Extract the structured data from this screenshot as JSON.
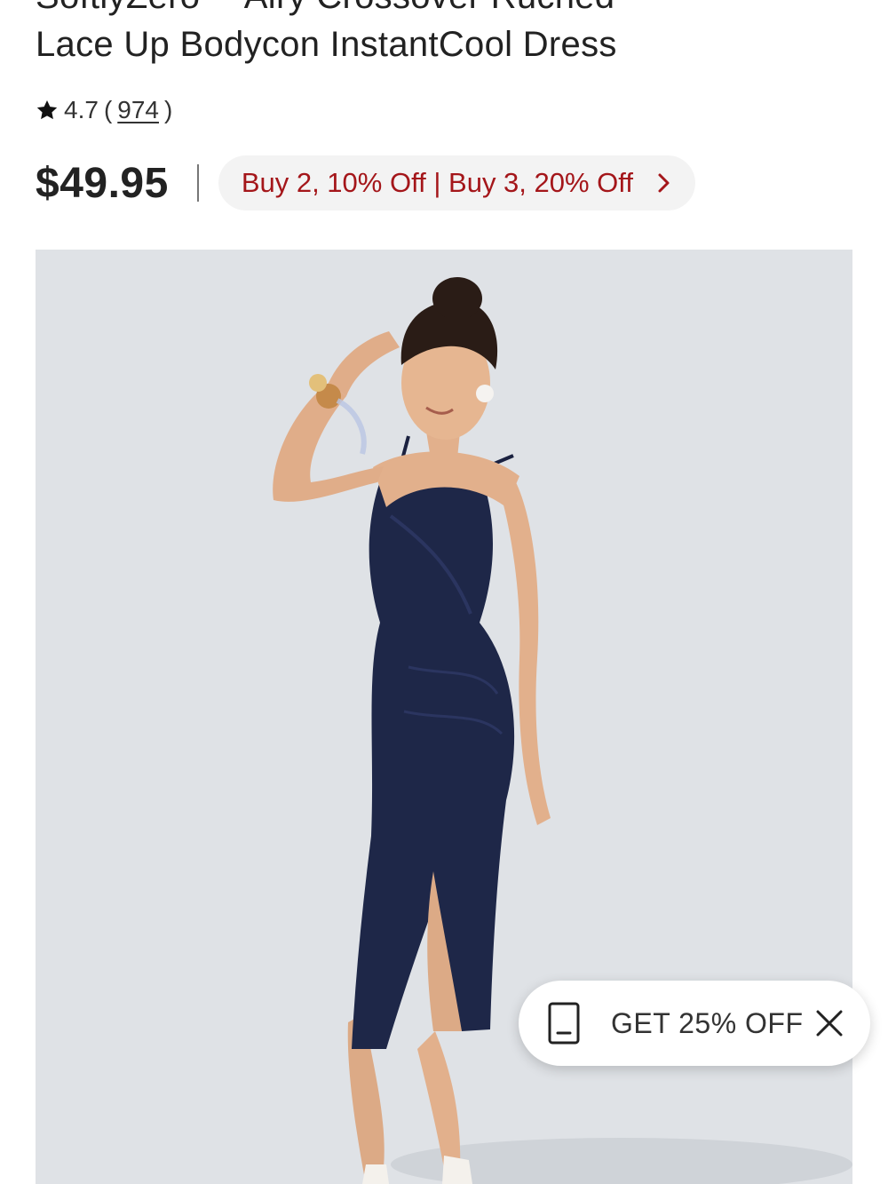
{
  "product": {
    "title_line1": "SoftlyZero™ Airy Crossover Ruched",
    "title_line2": "Lace Up Bodycon InstantCool Dress",
    "rating": {
      "score": "4.7",
      "open_paren": "(",
      "count": "974",
      "close_paren": ")"
    },
    "price": "$49.95",
    "promo": "Buy 2, 10% Off | Buy 3, 20% Off"
  },
  "coupon_popup": {
    "text": "GET 25% OFF"
  },
  "icons": {
    "rating": "star-icon",
    "promo": "chevron-right-icon",
    "coupon": "coupon-tag-icon",
    "close": "close-icon"
  },
  "colors": {
    "promo_text": "#a4161a",
    "promo_bg": "#f3f3f3",
    "hero_bg": "#dfe2e6",
    "dress": "#1e2748"
  }
}
